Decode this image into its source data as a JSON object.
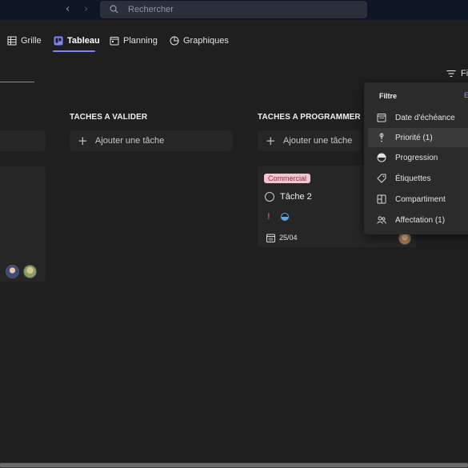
{
  "titlebar": {
    "nav_back": "‹",
    "nav_forward": "›",
    "search_placeholder": "Rechercher"
  },
  "tabs": [
    {
      "label": "Grille",
      "icon": "grid-icon",
      "active": false
    },
    {
      "label": "Tableau",
      "icon": "board-icon",
      "active": true
    },
    {
      "label": "Planning",
      "icon": "calendar-icon",
      "active": false
    },
    {
      "label": "Graphiques",
      "icon": "chart-icon",
      "active": false
    }
  ],
  "toolbar": {
    "filter_label": "Fi"
  },
  "columns": [
    {
      "title": "TACHES A VALIDER",
      "add_label": "Ajouter une tâche"
    },
    {
      "title": "TACHES A PROGRAMMER",
      "add_label": "Ajouter une tâche"
    }
  ],
  "card": {
    "tag": "Commercial",
    "title": "Tâche 2",
    "priority_mark": "!",
    "due_date": "25/04"
  },
  "filter_panel": {
    "title": "Filtre",
    "link_partial": "E",
    "items": [
      {
        "label": "Date d'échéance",
        "icon": "calendar-icon",
        "highlighted": false
      },
      {
        "label": "Priorité (1)",
        "icon": "priority-icon",
        "highlighted": true
      },
      {
        "label": "Progression",
        "icon": "progress-icon",
        "highlighted": false
      },
      {
        "label": "Étiquettes",
        "icon": "tag-icon",
        "highlighted": false
      },
      {
        "label": "Compartiment",
        "icon": "bucket-icon",
        "highlighted": false
      },
      {
        "label": "Affectation (1)",
        "icon": "people-icon",
        "highlighted": false
      }
    ]
  },
  "colors": {
    "accent": "#7f85f5",
    "tag_bg": "#f4c6cc",
    "priority": "#e0455a",
    "progress": "#5aa6e6"
  }
}
